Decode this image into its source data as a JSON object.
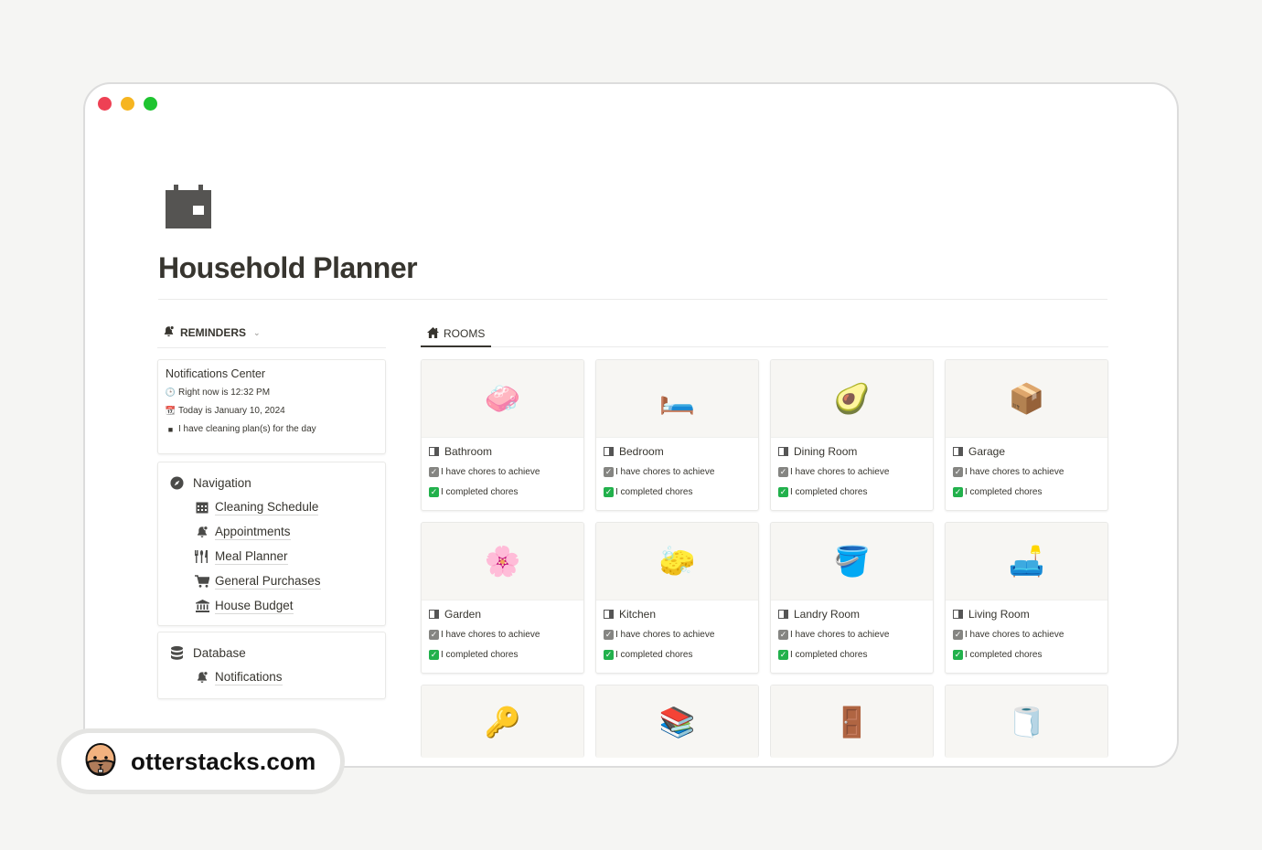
{
  "window": {
    "controls": [
      "close",
      "minimize",
      "maximize"
    ]
  },
  "page": {
    "icon": "calendar-icon",
    "title": "Household Planner"
  },
  "reminders": {
    "header": "REMINDERS",
    "header_icon": "bell-icon",
    "notifications_center": {
      "title": "Notifications Center",
      "lines": [
        {
          "icon": "clock-icon",
          "glyph": "🕒",
          "text": "Right now is 12:32 PM"
        },
        {
          "icon": "calendar-icon",
          "glyph": "📆",
          "text": "Today is January 10, 2024"
        },
        {
          "icon": "square-bullet-icon",
          "glyph": "■",
          "text": "I have cleaning plan(s) for the day"
        }
      ]
    },
    "navigation": {
      "title": "Navigation",
      "icon": "compass-icon",
      "items": [
        {
          "label": "Cleaning Schedule",
          "icon": "calendar-grid-icon"
        },
        {
          "label": "Appointments",
          "icon": "bell-icon"
        },
        {
          "label": "Meal Planner",
          "icon": "utensils-icon"
        },
        {
          "label": "General Purchases",
          "icon": "cart-icon"
        },
        {
          "label": "House Budget",
          "icon": "bank-icon"
        }
      ]
    },
    "database": {
      "title": "Database",
      "icon": "database-icon",
      "items": [
        {
          "label": "Notifications",
          "icon": "bell-icon"
        }
      ]
    }
  },
  "rooms": {
    "tab_label": "ROOMS",
    "tab_icon": "home-icon",
    "cards": [
      {
        "name": "Bathroom",
        "emoji": "🧼",
        "line1": "I have chores to achieve",
        "line2": "I completed chores"
      },
      {
        "name": "Bedroom",
        "emoji": "🛏️",
        "line1": "I have chores to achieve",
        "line2": "I completed chores"
      },
      {
        "name": "Dining Room",
        "emoji": "🥑",
        "line1": "I have chores to achieve",
        "line2": "I completed chores"
      },
      {
        "name": "Garage",
        "emoji": "📦",
        "line1": "I have chores to achieve",
        "line2": "I completed chores"
      },
      {
        "name": "Garden",
        "emoji": "🌸",
        "line1": "I have chores to achieve",
        "line2": "I completed chores"
      },
      {
        "name": "Kitchen",
        "emoji": "🧽",
        "line1": "I have chores to achieve",
        "line2": "I completed chores"
      },
      {
        "name": "Landry Room",
        "emoji": "🪣",
        "line1": "I have chores to achieve",
        "line2": "I completed chores"
      },
      {
        "name": "Living Room",
        "emoji": "🛋️",
        "line1": "I have chores to achieve",
        "line2": "I completed chores"
      }
    ],
    "partial_cards": [
      {
        "emoji": "🔑"
      },
      {
        "emoji": "📚"
      },
      {
        "emoji": "🚪"
      },
      {
        "emoji": "🧻"
      }
    ]
  },
  "branding": {
    "text": "otterstacks.com",
    "logo": "otter-face-icon"
  },
  "colors": {
    "close": "#ee4154",
    "minimize": "#f6b520",
    "maximize": "#1ec430",
    "text": "#37352f",
    "checkbox_green": "#22b14c",
    "checkbox_grey": "#858582"
  }
}
